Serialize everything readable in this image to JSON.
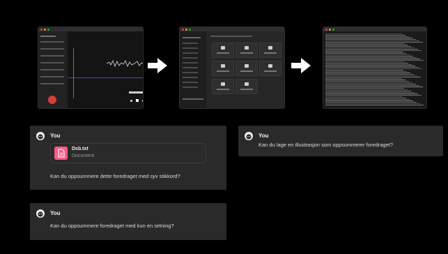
{
  "thumbnails": [
    {
      "name": "voice-memos-screenshot",
      "time_readout": "00:00,00"
    },
    {
      "name": "transcription-app-screenshot"
    },
    {
      "name": "transcript-text-screenshot"
    }
  ],
  "arrows": [
    "arrow-right-icon",
    "arrow-right-icon"
  ],
  "messages": [
    {
      "author": "You",
      "attachment": {
        "name": "Dsb.txt",
        "type": "Document"
      },
      "text": "Kan du oppsummere dette foredraget med syv stikkord?"
    },
    {
      "author": "You",
      "text": "Kan du lage en illustrasjon som oppsummerer foredraget?"
    },
    {
      "author": "You",
      "text": "Kan du oppsummere foredraget med kun en setning?"
    }
  ],
  "colors": {
    "background": "#000000",
    "card": "#2a2a2a",
    "file_icon": "#ff5a86",
    "record": "#d93b36"
  }
}
